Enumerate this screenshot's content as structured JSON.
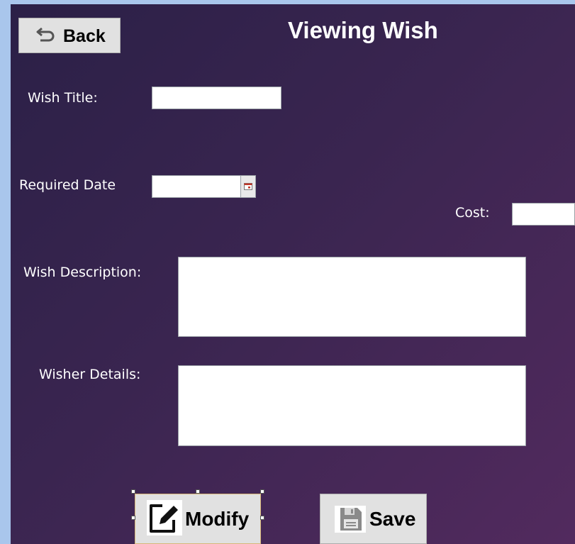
{
  "header": {
    "title": "Viewing Wish"
  },
  "back_button": {
    "label": "Back",
    "icon": "undo-arrow-icon"
  },
  "fields": {
    "wish_title": {
      "label": "Wish Title:",
      "value": ""
    },
    "required_date": {
      "label": "Required Date",
      "value": "",
      "icon": "calendar-icon"
    },
    "cost": {
      "label": "Cost:",
      "value": ""
    },
    "wish_description": {
      "label": "Wish Description:",
      "value": ""
    },
    "wisher_details": {
      "label": "Wisher Details:",
      "value": ""
    }
  },
  "actions": {
    "modify": {
      "label": "Modify",
      "icon": "edit-icon"
    },
    "save": {
      "label": "Save",
      "icon": "floppy-disk-icon"
    }
  },
  "colors": {
    "background_start": "#2b2047",
    "background_end": "#522a5e",
    "desktop": "#a9c6ec",
    "button_face": "#e1e1e1"
  }
}
